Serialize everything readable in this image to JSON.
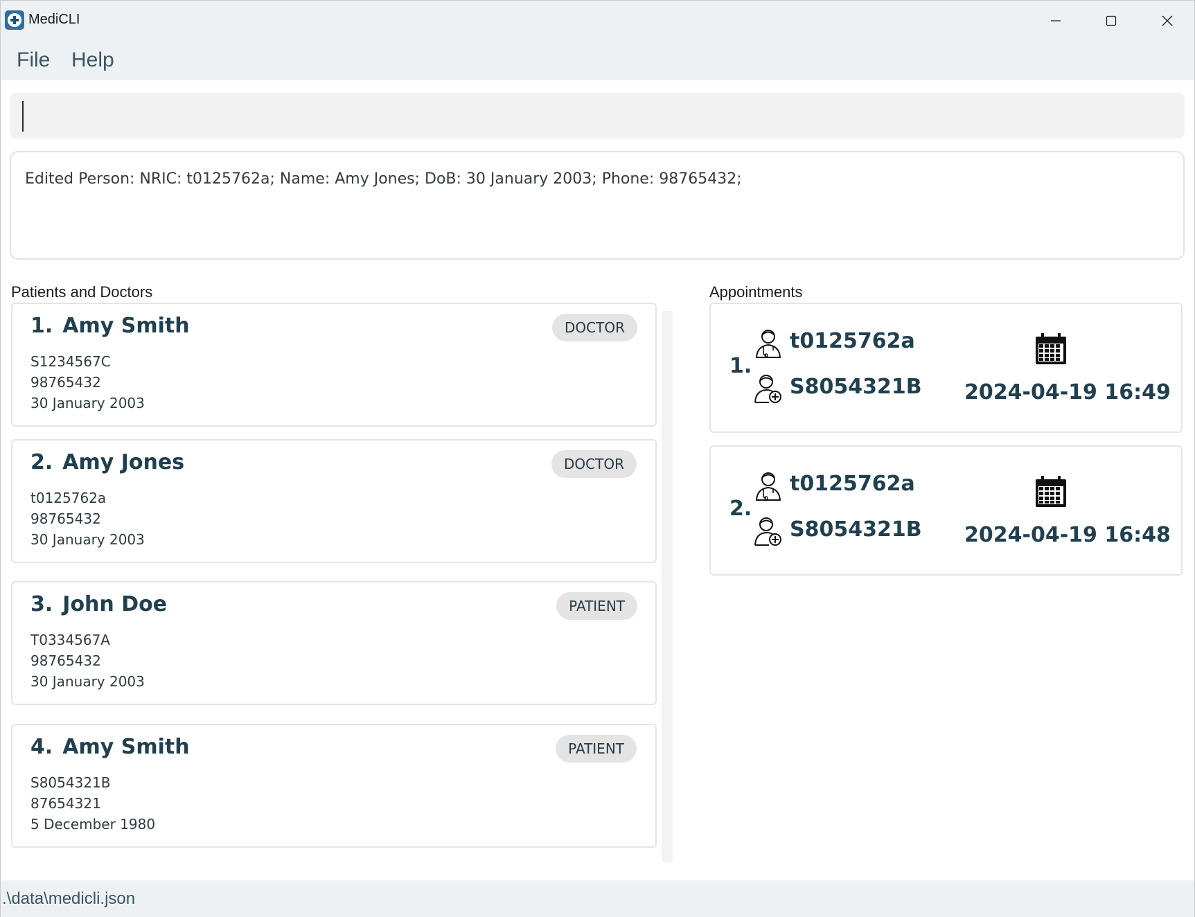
{
  "window": {
    "title": "MediCLI",
    "controls": {
      "minimize": "minimize-icon",
      "maximize": "maximize-icon",
      "close": "close-icon"
    }
  },
  "menu": {
    "file": "File",
    "help": "Help"
  },
  "command": {
    "value": ""
  },
  "result": {
    "text": "Edited Person: NRIC: t0125762a; Name: Amy Jones; DoB: 30 January 2003; Phone: 98765432;"
  },
  "sections": {
    "persons": "Patients and Doctors",
    "appointments": "Appointments"
  },
  "persons": [
    {
      "index": "1.",
      "name": "Amy Smith",
      "role": "DOCTOR",
      "nric": "S1234567C",
      "phone": "98765432",
      "dob": "30 January 2003"
    },
    {
      "index": "2.",
      "name": "Amy Jones",
      "role": "DOCTOR",
      "nric": "t0125762a",
      "phone": "98765432",
      "dob": "30 January 2003"
    },
    {
      "index": "3.",
      "name": "John Doe",
      "role": "PATIENT",
      "nric": "T0334567A",
      "phone": "98765432",
      "dob": "30 January 2003"
    },
    {
      "index": "4.",
      "name": "Amy Smith",
      "role": "PATIENT",
      "nric": "S8054321B",
      "phone": "87654321",
      "dob": "5 December 1980"
    }
  ],
  "appointments": [
    {
      "index": "1.",
      "doctor_nric": "t0125762a",
      "patient_nric": "S8054321B",
      "datetime": "2024-04-19 16:49"
    },
    {
      "index": "2.",
      "doctor_nric": "t0125762a",
      "patient_nric": "S8054321B",
      "datetime": "2024-04-19 16:48"
    }
  ],
  "status": {
    "path": ".\\data\\medicli.json"
  },
  "colors": {
    "heading": "#21404f",
    "badge_bg": "#e4e4e4",
    "bars": "#eef1f4"
  }
}
